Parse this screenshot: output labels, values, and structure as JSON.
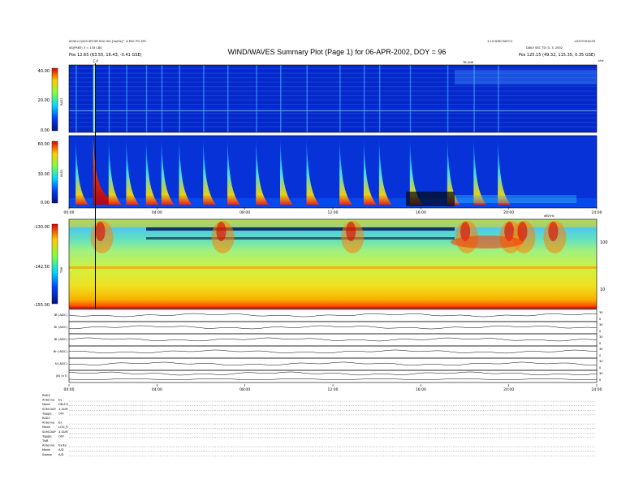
{
  "header": {
    "title": "WIND/WAVES Summary Plot (Page 1) for 06-APR-2002, DOY = 96",
    "left_line1": "AS30>2(200 SPCSR SGG S0) [Vo/Hz]^  A RSC PG SPC",
    "left_line2": "AS(FREE) 3 = 135 C80",
    "left_line3": "Pos 12.65 (63.55, 16.43, -0.41 GSE)",
    "right_line1": "1.10 WSD DA7CC",
    "right_line2": "LGS7COH/n50",
    "right_line3": "DAILY SEC TD (3, 3, 2002",
    "right_line4": "Pos 125.15 (49.32, 115.35, 0.35 GSE)"
  },
  "panels": {
    "rad2": {
      "label": "RAD2",
      "yticks": [
        "40.00",
        "20.00",
        "0.00"
      ],
      "top_marker": "TB.UNK",
      "right_unit": "kHz"
    },
    "rad1": {
      "label": "RAD1",
      "yticks": [
        "60.00",
        "30.00",
        "0.00"
      ]
    },
    "tnr": {
      "label": "TNR",
      "yticks": [
        "-130.00",
        "-142.50",
        "-155.00"
      ],
      "right_ticks": [
        "100",
        "10"
      ],
      "top_marker": "dBV/Hz"
    }
  },
  "markers": {
    "cursor_label": "C-f"
  },
  "time_ticks": [
    "00:00",
    "04:00",
    "08:00",
    "12:00",
    "16:00",
    "20:00",
    "24:00"
  ],
  "strips": [
    {
      "label": "Bt (ADC)",
      "ticks": [
        "30",
        "0"
      ]
    },
    {
      "label": "Br (ADC)",
      "ticks": [
        "30",
        "0"
      ]
    },
    {
      "label": "Bt (ADC)",
      "ticks": [
        "30",
        "0"
      ]
    },
    {
      "label": "Bn (ADC)",
      "ticks": [
        "30",
        "0"
      ]
    },
    {
      "label": "N (ADC)",
      "ticks": [
        "30",
        "0"
      ]
    },
    {
      "label": "|B| (nT)",
      "ticks": [
        "30",
        "0"
      ]
    }
  ],
  "footer_blocks": [
    {
      "title": "RAD2",
      "rows": [
        [
          "Antenna",
          "Ey"
        ],
        [
          "Mode",
          "DELFQ"
        ],
        [
          "SUM-DAP",
          "3-SUM"
        ],
        [
          "Toggle",
          "OFF"
        ]
      ]
    },
    {
      "title": "RAD1",
      "rows": [
        [
          "Antenna",
          "Ex"
        ],
        [
          "Mode",
          "LOG_R"
        ],
        [
          "SUM-DAP",
          "3-SUM"
        ],
        [
          "Toggle",
          "OFF"
        ]
      ]
    },
    {
      "title": "TNR",
      "rows": [
        [
          "Antenna",
          "Ex/Ey"
        ],
        [
          "Mode",
          "A/D"
        ],
        [
          "Sweep",
          "A/D"
        ]
      ]
    }
  ],
  "chart_data": {
    "type": "heatmap",
    "x_unit": "hours UT",
    "xlim": [
      0,
      24
    ],
    "rad1_bursts_hours": [
      0.3,
      1.1,
      1.8,
      2.6,
      3.5,
      4.2,
      5.0,
      6.1,
      7.2,
      8.5,
      9.6,
      10.8,
      12.3,
      13.4,
      14.1,
      15.5,
      17.2,
      18.4,
      19.5
    ],
    "strong_bursts_hours": [
      0.9,
      6.5,
      12.8
    ],
    "tnr_enhancements_hours": [
      1.2,
      6.7,
      12.6,
      17.8,
      19.8,
      20.4,
      21.8
    ],
    "cursor_hour": 1.2
  }
}
